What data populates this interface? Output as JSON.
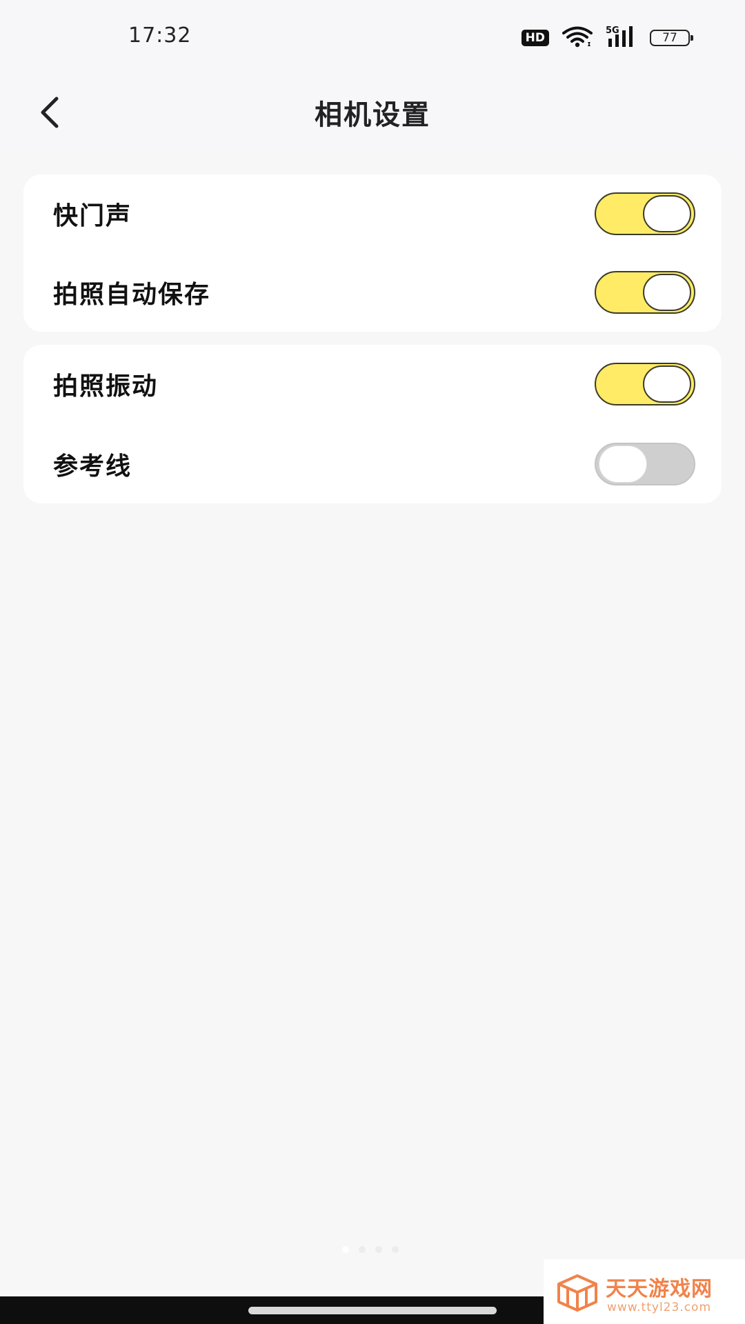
{
  "status_bar": {
    "time": "17:32",
    "hd_label": "HD",
    "network_label": "5G",
    "battery_level": "77"
  },
  "header": {
    "title": "相机设置",
    "back_icon": "chevron-left-icon"
  },
  "settings": {
    "group1": [
      {
        "label": "快门声",
        "enabled": true
      },
      {
        "label": "拍照自动保存",
        "enabled": true
      }
    ],
    "group2": [
      {
        "label": "拍照振动",
        "enabled": true
      },
      {
        "label": "参考线",
        "enabled": false
      }
    ]
  },
  "colors": {
    "toggle_on": "#ffeb66",
    "toggle_off": "#cfcfcf",
    "watermark_accent": "#f0834a"
  },
  "watermark": {
    "title": "天天游戏网",
    "url": "www.ttyl23.com"
  }
}
